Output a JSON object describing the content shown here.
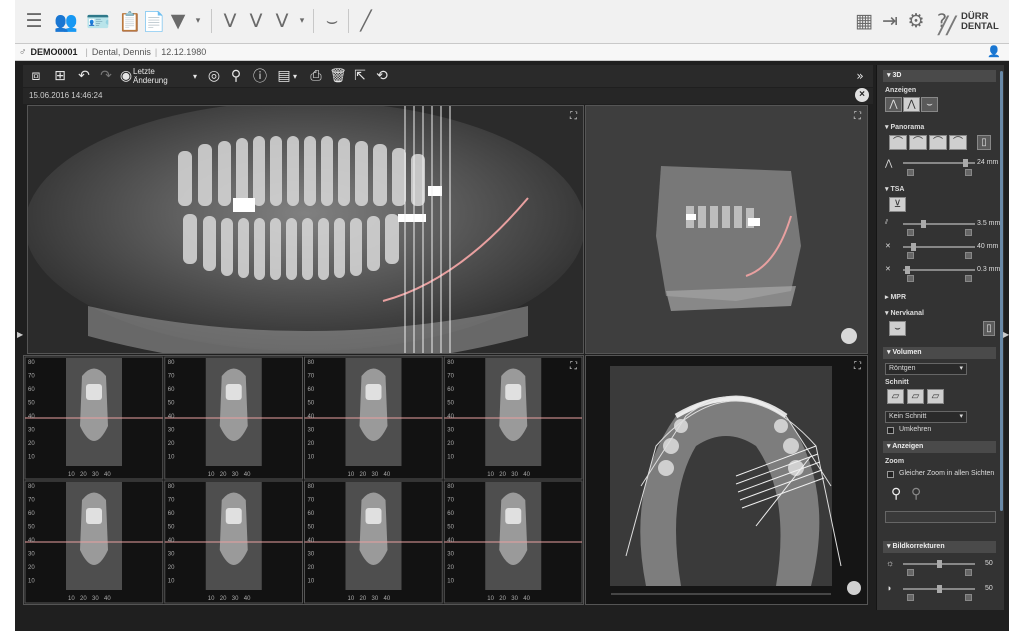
{
  "patient": {
    "id": "DEMO0001",
    "name": "Dental, Dennis",
    "dob": "12.12.1980"
  },
  "brand": {
    "line1": "DÜRR",
    "line2": "DENTAL"
  },
  "viewer_toolbar": {
    "last_change": "Letzte Änderung",
    "collapse_symbol": "»"
  },
  "study": {
    "timestamp": "15.06.2016 14:46:24"
  },
  "panel": {
    "section_3d": "3D",
    "anzeigen": "Anzeigen",
    "panorama": "Panorama",
    "panorama_value": "24 mm",
    "tsa": "TSA",
    "tsa_values": [
      "3.5 mm",
      "40 mm",
      "0.3 mm"
    ],
    "mpr": "MPR",
    "nervkanal": "Nervkanal",
    "volumen": "Volumen",
    "volumen_select": "Röntgen",
    "schnitt": "Schnitt",
    "schnitt_select": "Kein Schnitt",
    "umkehren": "Umkehren",
    "anzeigen2": "Anzeigen",
    "zoom": "Zoom",
    "same_zoom": "Gleicher Zoom in allen Sichten",
    "bildkorrekturen": "Bildkorrekturen",
    "brightness_value": "50",
    "contrast_value": "50"
  },
  "cross_sections": {
    "y_ticks": [
      "80",
      "70",
      "60",
      "50",
      "40",
      "30",
      "20",
      "10"
    ],
    "x_ticks": [
      "10",
      "20",
      "30",
      "40"
    ]
  },
  "icons": {
    "app_toolbar": [
      "list-icon",
      "patients-icon",
      "patient-card-icon",
      "clipboard-icon",
      "document-icon",
      "tooth-icon",
      "arch-icon",
      "arch-outline-icon",
      "arch-select-icon",
      "implant-icon",
      "pen-icon"
    ],
    "app_right": [
      "monitor-icon",
      "logout-icon",
      "settings-icon",
      "help-icon"
    ]
  },
  "colors": {
    "accent": "#6a8aa8",
    "cut_line": "#e8a0a0"
  }
}
